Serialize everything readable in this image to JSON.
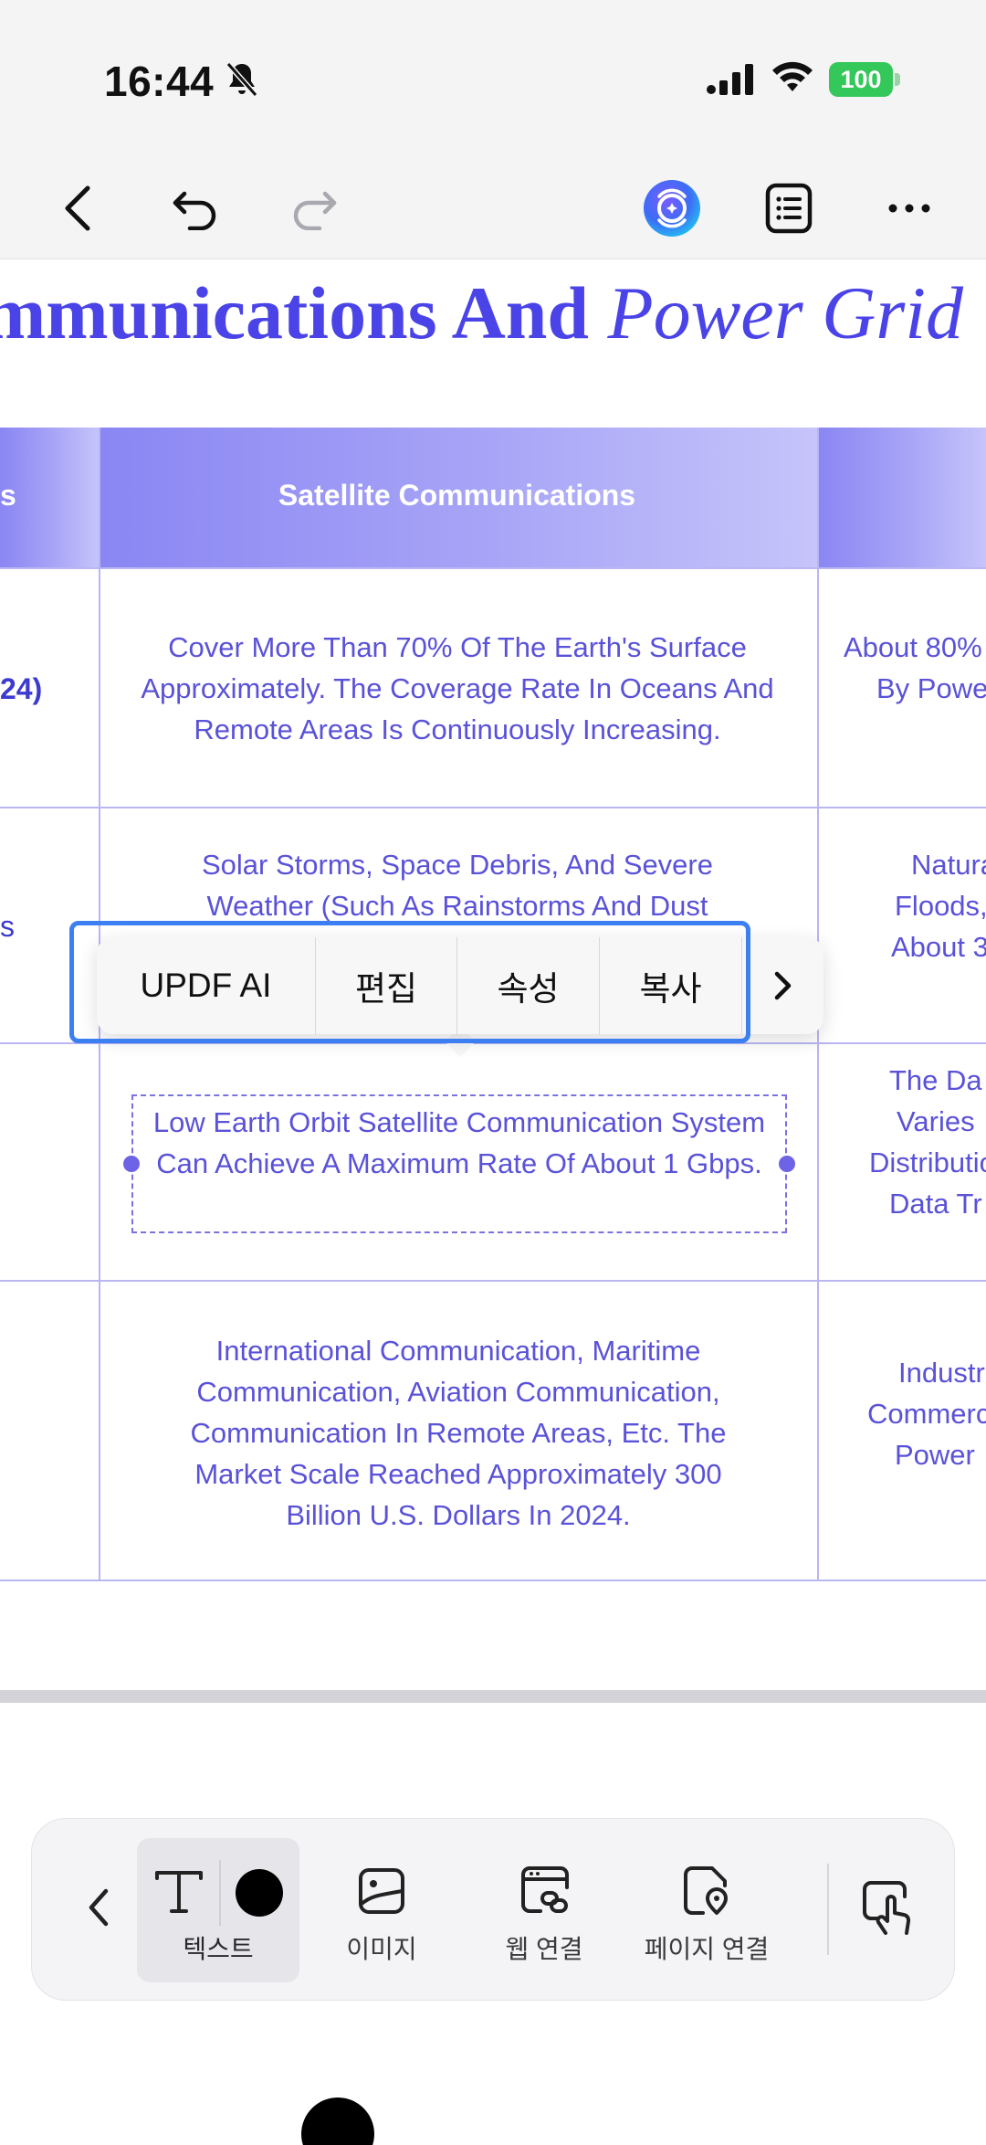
{
  "status_bar": {
    "time": "16:44",
    "battery_level": "100",
    "icons": [
      "bell-slash-icon",
      "cellular-signal-icon",
      "wifi-icon",
      "battery-icon"
    ],
    "colors": {
      "battery": "#34c759"
    }
  },
  "toolbar": {
    "icons": [
      "back-chevron-icon",
      "undo-icon",
      "redo-icon",
      "updf-ai-icon",
      "outline-list-icon",
      "more-icon"
    ]
  },
  "document": {
    "title_part1": "mmunications And",
    "title_part2": "Power Grid",
    "header_left": "s",
    "header_center": "Satellite Communications",
    "rows": [
      {
        "left": "24)",
        "center": "Cover More Than 70% Of The Earth's Surface Approximately. The Coverage Rate In Oceans And Remote Areas Is Continuously Increasing.",
        "right_lines": [
          "About 80%",
          "By Powe"
        ]
      },
      {
        "left": "s",
        "center_lines": [
          "Solar Storms, Space Debris, And Severe",
          "Weather (Such As Rainstorms And Dust"
        ],
        "right_lines": [
          "Natura",
          "Floods,",
          "About 3"
        ]
      },
      {
        "left": "",
        "center": "Low Earth Orbit Satellite Communication System Can Achieve A Maximum Rate Of About 1 Gbps.",
        "right_lines": [
          "The Da",
          "Varies",
          "Distributio",
          "Data Tr"
        ]
      },
      {
        "left": "",
        "center": "International Communication, Maritime Communication, Aviation Communication, Communication In Remote Areas, Etc. The Market Scale Reached Approximately 300 Billion U.S. Dollars In 2024.",
        "right_lines": [
          "Industr",
          "Commerc",
          "Power"
        ]
      }
    ],
    "colors": {
      "title": "#4a44e8",
      "cell_text": "#5a52d8",
      "header_bg": "#8a86f3",
      "grid_line": "#b9b6f2"
    }
  },
  "context_menu": {
    "items": [
      "UPDF AI",
      "편집",
      "속성",
      "복사"
    ],
    "more_icon": "chevron-right-icon"
  },
  "bottom_toolbar": {
    "items": [
      {
        "label": "텍스트",
        "icon": "text-icon",
        "active": true
      },
      {
        "label": "이미지",
        "icon": "image-icon",
        "active": false
      },
      {
        "label": "웹 연결",
        "icon": "web-link-icon",
        "active": false
      },
      {
        "label": "페이지 연결",
        "icon": "page-link-icon",
        "active": false
      }
    ],
    "text_color": "#000000",
    "back_icon": "chevron-left-icon",
    "tap_mode_icon": "hand-tap-icon"
  }
}
